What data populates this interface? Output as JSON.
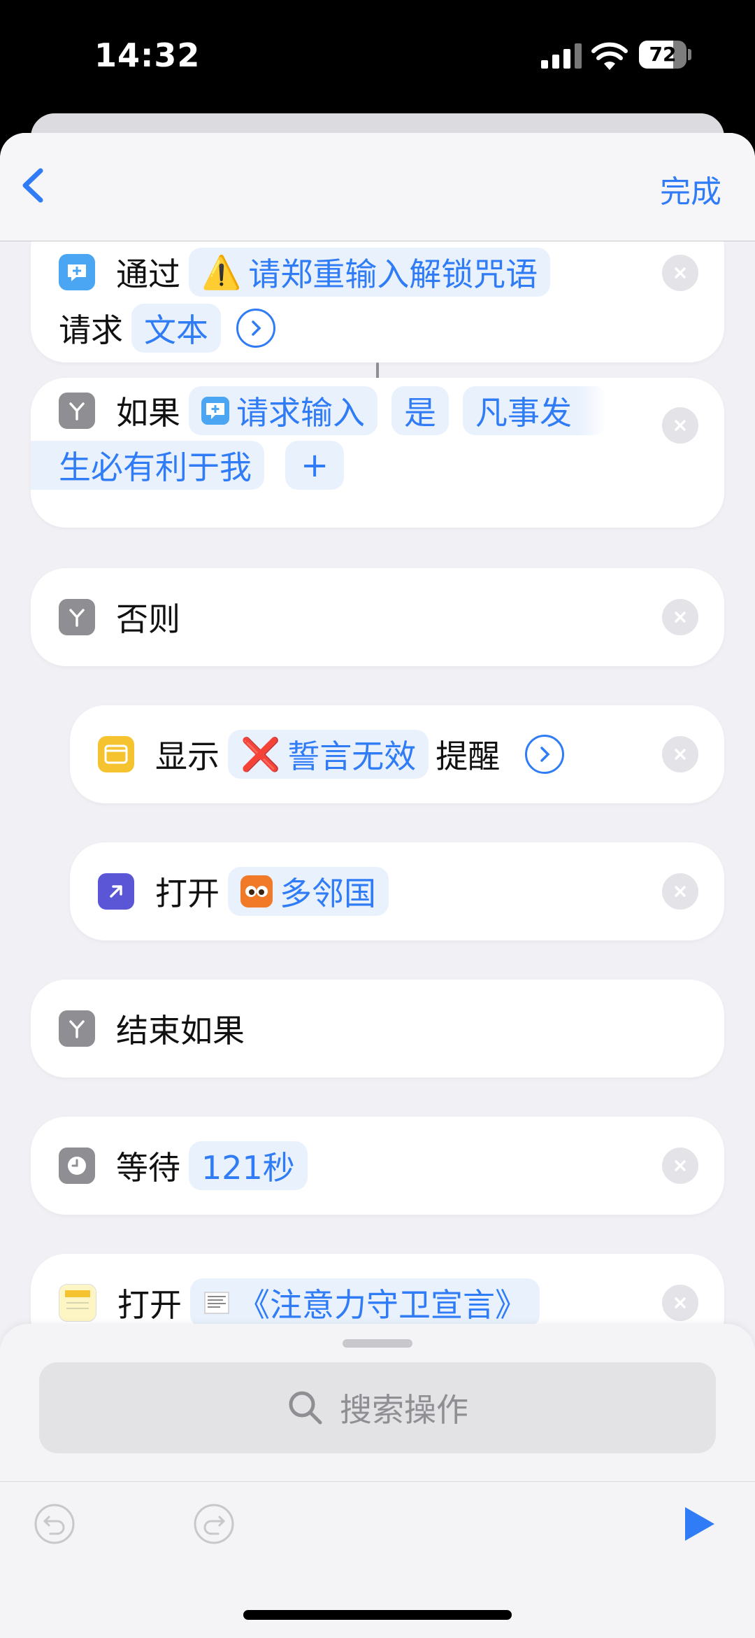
{
  "status": {
    "time": "14:32",
    "battery": "72",
    "battery_level": 0.72
  },
  "nav": {
    "done": "完成"
  },
  "actions": {
    "ask": {
      "prefix": "通过",
      "prompt": "请郑重输入解锁咒语",
      "prompt_emoji": "⚠️",
      "label2": "请求",
      "type": "文本"
    },
    "if": {
      "label": "如果",
      "var": "请求输入",
      "op": "是",
      "value1": "凡事发",
      "value2": "生必有利于我",
      "add": "+"
    },
    "otherwise": {
      "label": "否则"
    },
    "alert": {
      "label": "显示",
      "emoji": "❌",
      "text": "誓言无效",
      "suffix": "提醒"
    },
    "open_app": {
      "label": "打开",
      "app": "多邻国"
    },
    "end_if": {
      "label": "结束如果"
    },
    "wait": {
      "label": "等待",
      "value": "121秒"
    },
    "open_note": {
      "label": "打开",
      "note": "《注意力守卫宣言》"
    }
  },
  "search": {
    "placeholder": "搜索操作"
  },
  "icons": {
    "back": "chevron-left-icon",
    "ask": "ask-for-input-icon",
    "if": "branch-icon",
    "alert": "alert-window-icon",
    "open": "open-app-icon",
    "wait": "clock-icon",
    "notes": "notes-icon",
    "remove": "close-icon",
    "search": "search-icon",
    "undo": "undo-icon",
    "redo": "redo-icon",
    "run": "play-icon"
  },
  "colors": {
    "accent": "#2f7cf6",
    "token_bg": "#e9f1fd",
    "background": "#f0f0f5"
  }
}
